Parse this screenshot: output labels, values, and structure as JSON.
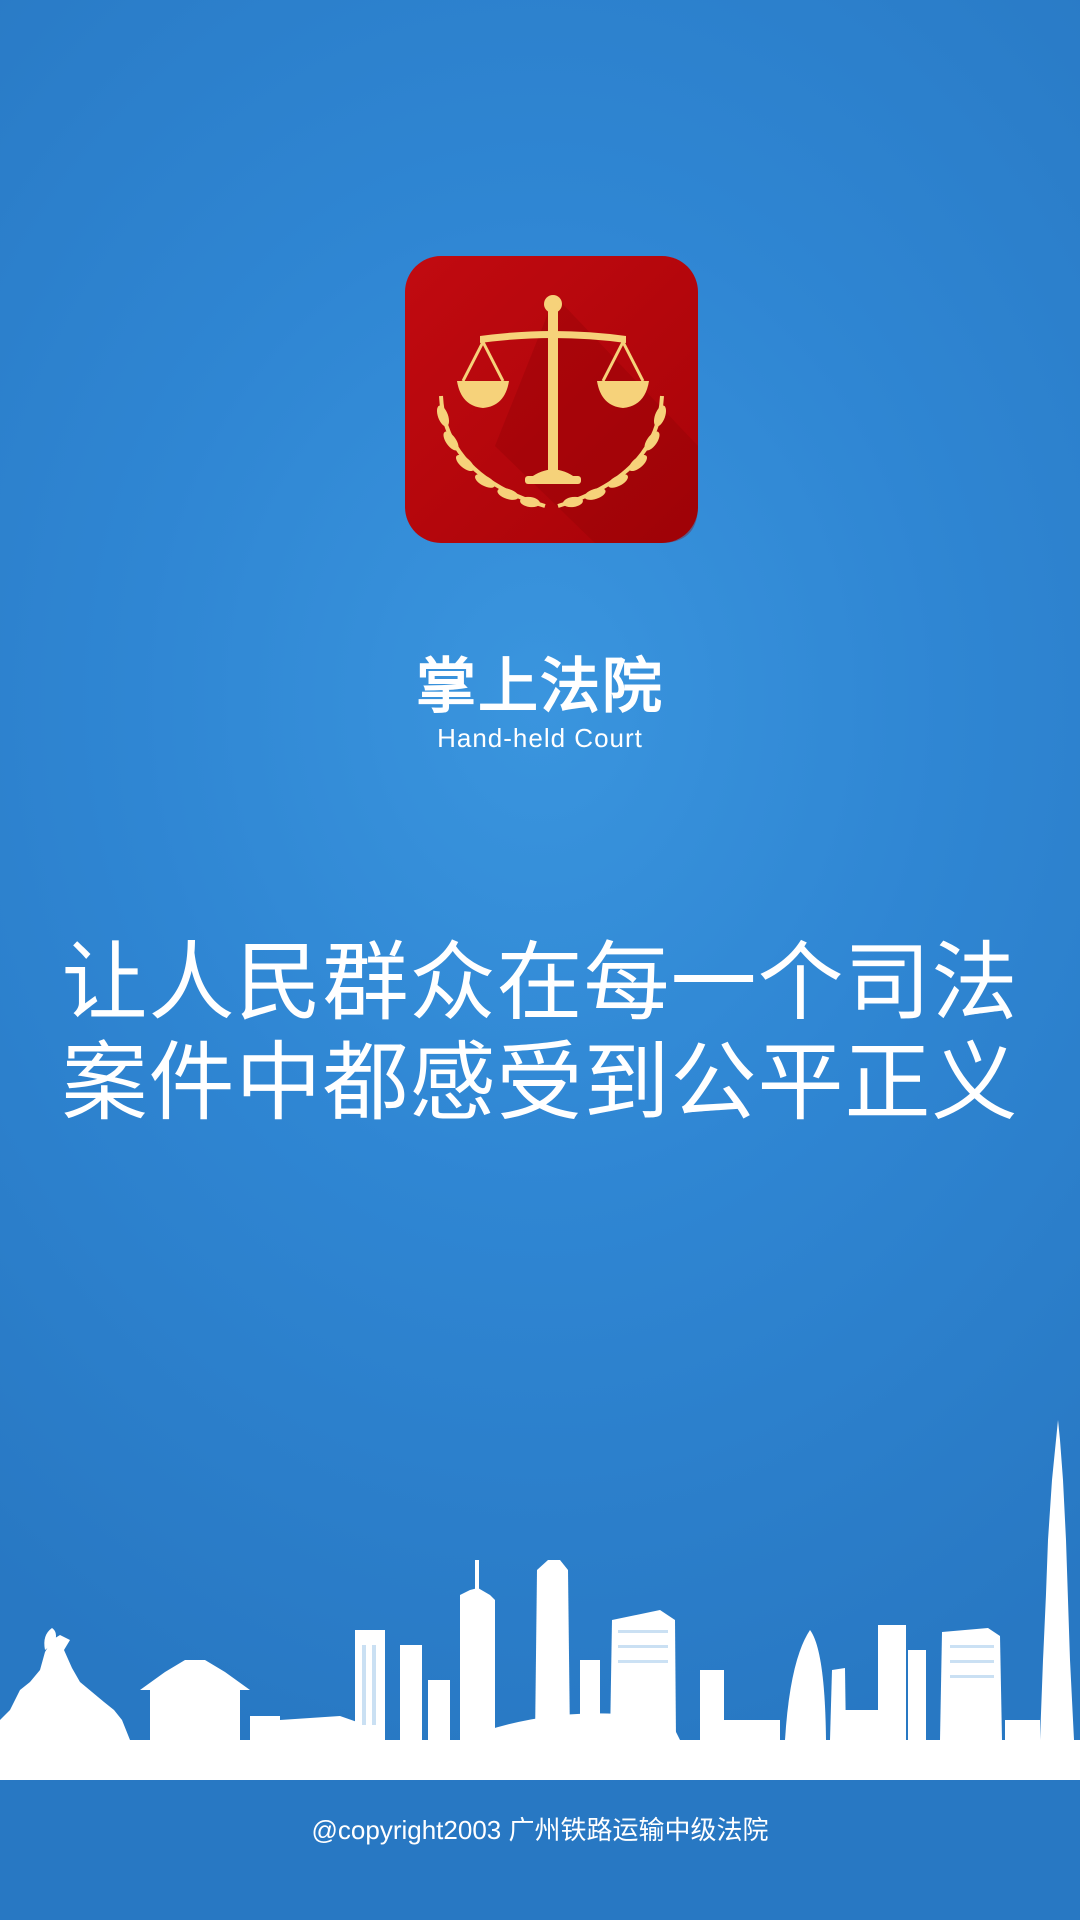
{
  "app": {
    "title": "掌上法院",
    "subtitle": "Hand-held Court",
    "icon": "scales-of-justice-icon"
  },
  "slogan": {
    "line1": "让人民群众在每一个司法",
    "line2": "案件中都感受到公平正义"
  },
  "footer": {
    "copyright": "@copyright2003  广州铁路运输中级法院"
  },
  "colors": {
    "background": "#2f86d3",
    "icon_red": "#b5060b",
    "icon_gold": "#f6d27a",
    "text": "#ffffff"
  }
}
